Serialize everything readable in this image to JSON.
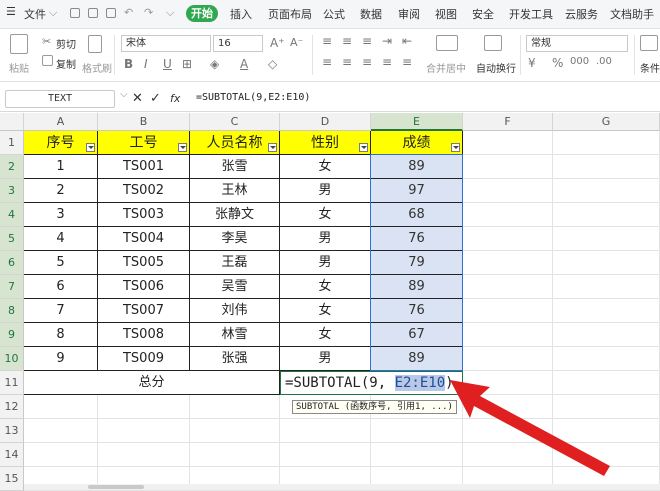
{
  "menubar": {
    "file_label": "文件",
    "tabs": [
      "开始",
      "插入",
      "页面布局",
      "公式",
      "数据",
      "审阅",
      "视图",
      "安全",
      "开发工具",
      "云服务",
      "文档助手"
    ],
    "active_tab": "开始"
  },
  "ribbon": {
    "paste_label": "粘贴",
    "cut_label": "剪切",
    "copy_label": "复制",
    "format_painter_label": "格式刷",
    "font_name": "宋体",
    "font_size": "16",
    "merge_label": "合并居中",
    "wrap_label": "自动换行",
    "number_format": "常规",
    "condition_label": "条件"
  },
  "formula_bar": {
    "name_box": "TEXT",
    "formula": "=SUBTOTAL(9,E2:E10)",
    "cancel_glyph": "✕",
    "confirm_glyph": "✓",
    "fx_label": "fx"
  },
  "grid": {
    "columns": [
      "A",
      "B",
      "C",
      "D",
      "E",
      "F",
      "G"
    ],
    "rows": [
      "1",
      "2",
      "3",
      "4",
      "5",
      "6",
      "7",
      "8",
      "9",
      "10",
      "11",
      "12",
      "13",
      "14",
      "15"
    ],
    "headers": [
      "序号",
      "工号",
      "人员名称",
      "性别",
      "成绩"
    ],
    "records": [
      [
        "1",
        "TS001",
        "张雪",
        "女",
        "89"
      ],
      [
        "2",
        "TS002",
        "王林",
        "男",
        "97"
      ],
      [
        "3",
        "TS003",
        "张静文",
        "女",
        "68"
      ],
      [
        "4",
        "TS004",
        "李昊",
        "男",
        "76"
      ],
      [
        "5",
        "TS005",
        "王磊",
        "男",
        "79"
      ],
      [
        "6",
        "TS006",
        "吴雪",
        "女",
        "89"
      ],
      [
        "7",
        "TS007",
        "刘伟",
        "女",
        "76"
      ],
      [
        "8",
        "TS008",
        "林雪",
        "女",
        "67"
      ],
      [
        "9",
        "TS009",
        "张强",
        "男",
        "89"
      ]
    ],
    "total_label": "总分",
    "editing_cell": {
      "prefix": "=SUBTOTAL(9, ",
      "ref": "E2:E10",
      "suffix": ")"
    },
    "tooltip": "SUBTOTAL (函数序号, 引用1, ...)"
  },
  "colors": {
    "header_fill": "#ffff00",
    "selection_fill": "#dae3f3",
    "active_tab_green": "#2fa84f",
    "arrow_red": "#e02020"
  }
}
